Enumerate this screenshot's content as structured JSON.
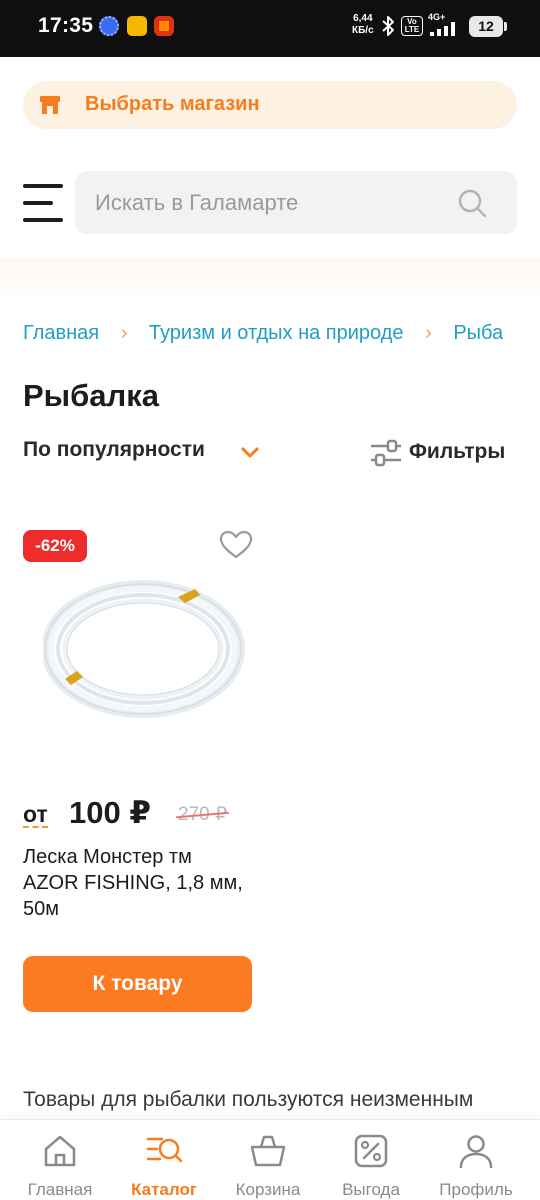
{
  "status_bar": {
    "time": "17:35",
    "speed_value": "6,44",
    "speed_unit": "КБ/с",
    "volte_label": "Vo LTE",
    "network_label": "4G+",
    "battery_level": "12"
  },
  "store_selector": {
    "label": "Выбрать магазин",
    "icon": "store-icon"
  },
  "search": {
    "placeholder": "Искать в Галамарте",
    "icon": "search-icon"
  },
  "breadcrumb": [
    "Главная",
    "Туризм и отдых на природе",
    "Рыба"
  ],
  "page": {
    "title": "Рыбалка",
    "sort_label": "По популярности",
    "filters_label": "Фильтры"
  },
  "product": {
    "discount": "-62%",
    "price_prefix": "от",
    "price": "100 ₽",
    "old_price": "270 ₽",
    "name": "Леска Монстер тм AZOR FISHING, 1,8 мм, 50м",
    "button_label": "К товару"
  },
  "seo_text": "Товары для рыбалки пользуются неизменным",
  "bottom_nav": [
    {
      "label": "Главная",
      "icon": "home-icon",
      "active": false
    },
    {
      "label": "Каталог",
      "icon": "catalog-icon",
      "active": true
    },
    {
      "label": "Корзина",
      "icon": "basket-icon",
      "active": false
    },
    {
      "label": "Выгода",
      "icon": "discount-icon",
      "active": false
    },
    {
      "label": "Профиль",
      "icon": "profile-icon",
      "active": false
    }
  ],
  "colors": {
    "accent": "#f57c1f",
    "button": "#fb7a22",
    "badge": "#ee2c2c",
    "link": "#1f9fc7",
    "store_pill_bg": "#fdf1e2"
  }
}
